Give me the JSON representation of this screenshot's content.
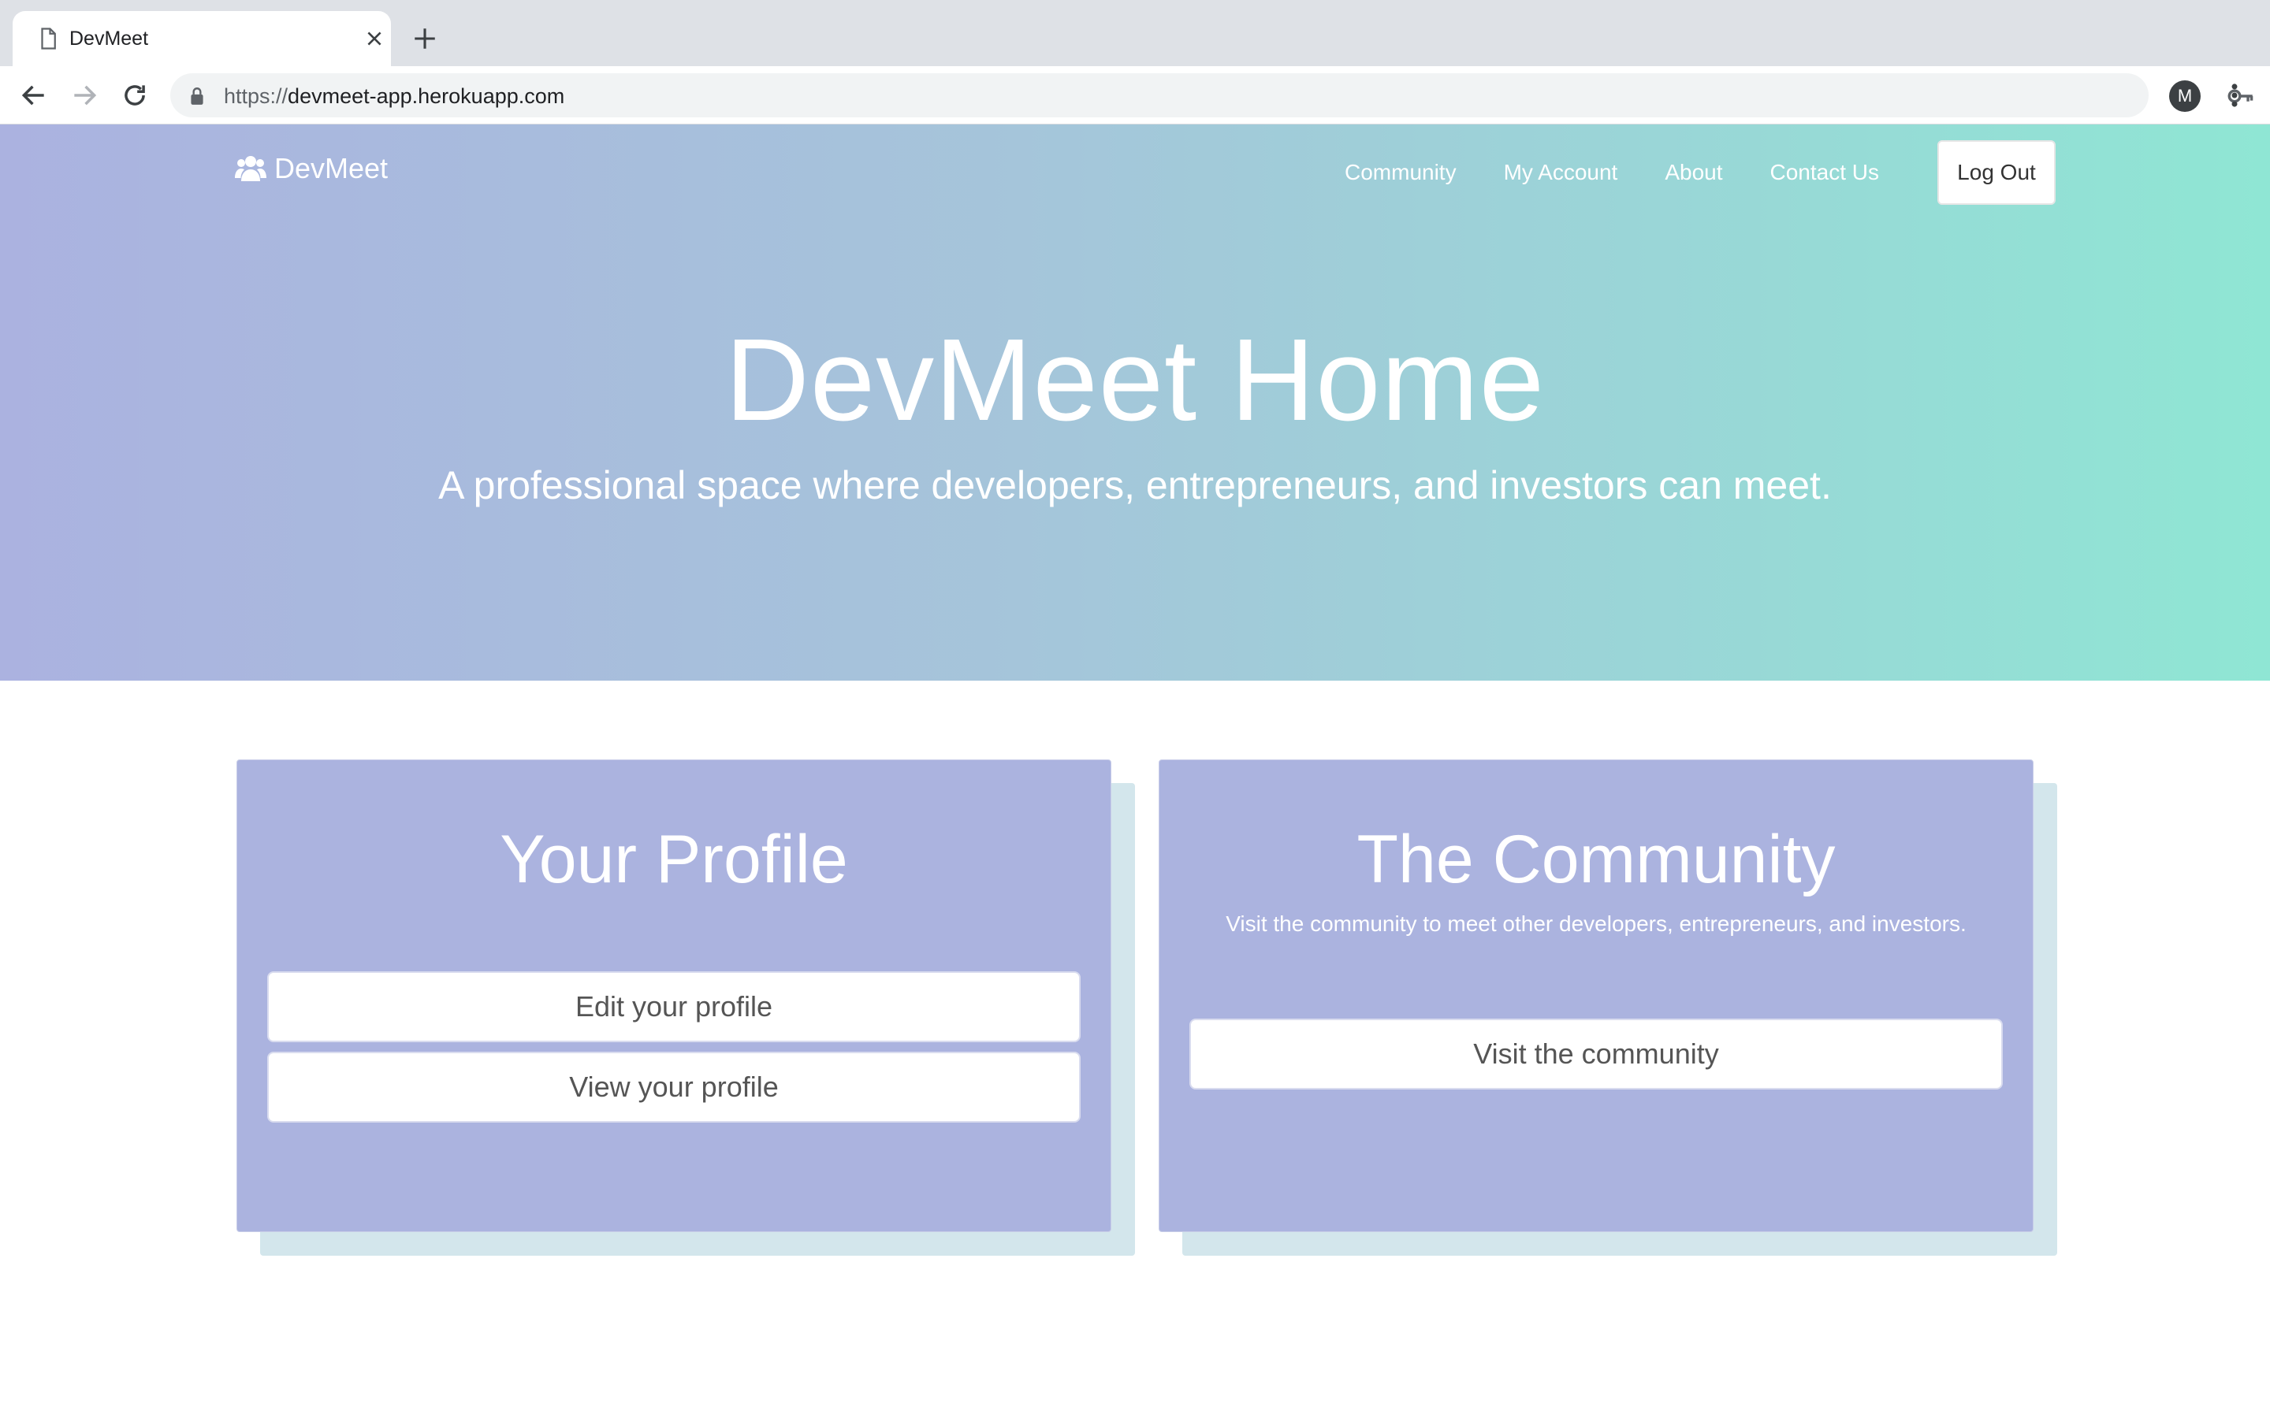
{
  "browser": {
    "tab_title": "DevMeet",
    "url_scheme": "https://",
    "url_host": "devmeet-app.herokuapp.com",
    "profile_initial": "M"
  },
  "navbar": {
    "brand": "DevMeet",
    "links": [
      "Community",
      "My Account",
      "About",
      "Contact Us"
    ],
    "logout_label": "Log Out"
  },
  "hero": {
    "title": "DevMeet Home",
    "subtitle": "A professional space where developers, entrepreneurs, and investors can meet."
  },
  "cards": {
    "profile": {
      "title": "Your Profile",
      "edit_label": "Edit your profile",
      "view_label": "View your profile"
    },
    "community": {
      "title": "The Community",
      "description": "Visit the community to meet other developers, entrepreneurs, and investors.",
      "visit_label": "Visit the community"
    }
  },
  "colors": {
    "hero_gradient_start": "#abb2e0",
    "hero_gradient_end": "#8fe6d4",
    "card_background": "#abb3df",
    "card_shadow": "#d3e6ec"
  },
  "icons": {
    "tab": "page-icon",
    "brand": "users-icon",
    "address": "lock-icon",
    "password": "key-icon",
    "bookmark": "star-icon"
  }
}
